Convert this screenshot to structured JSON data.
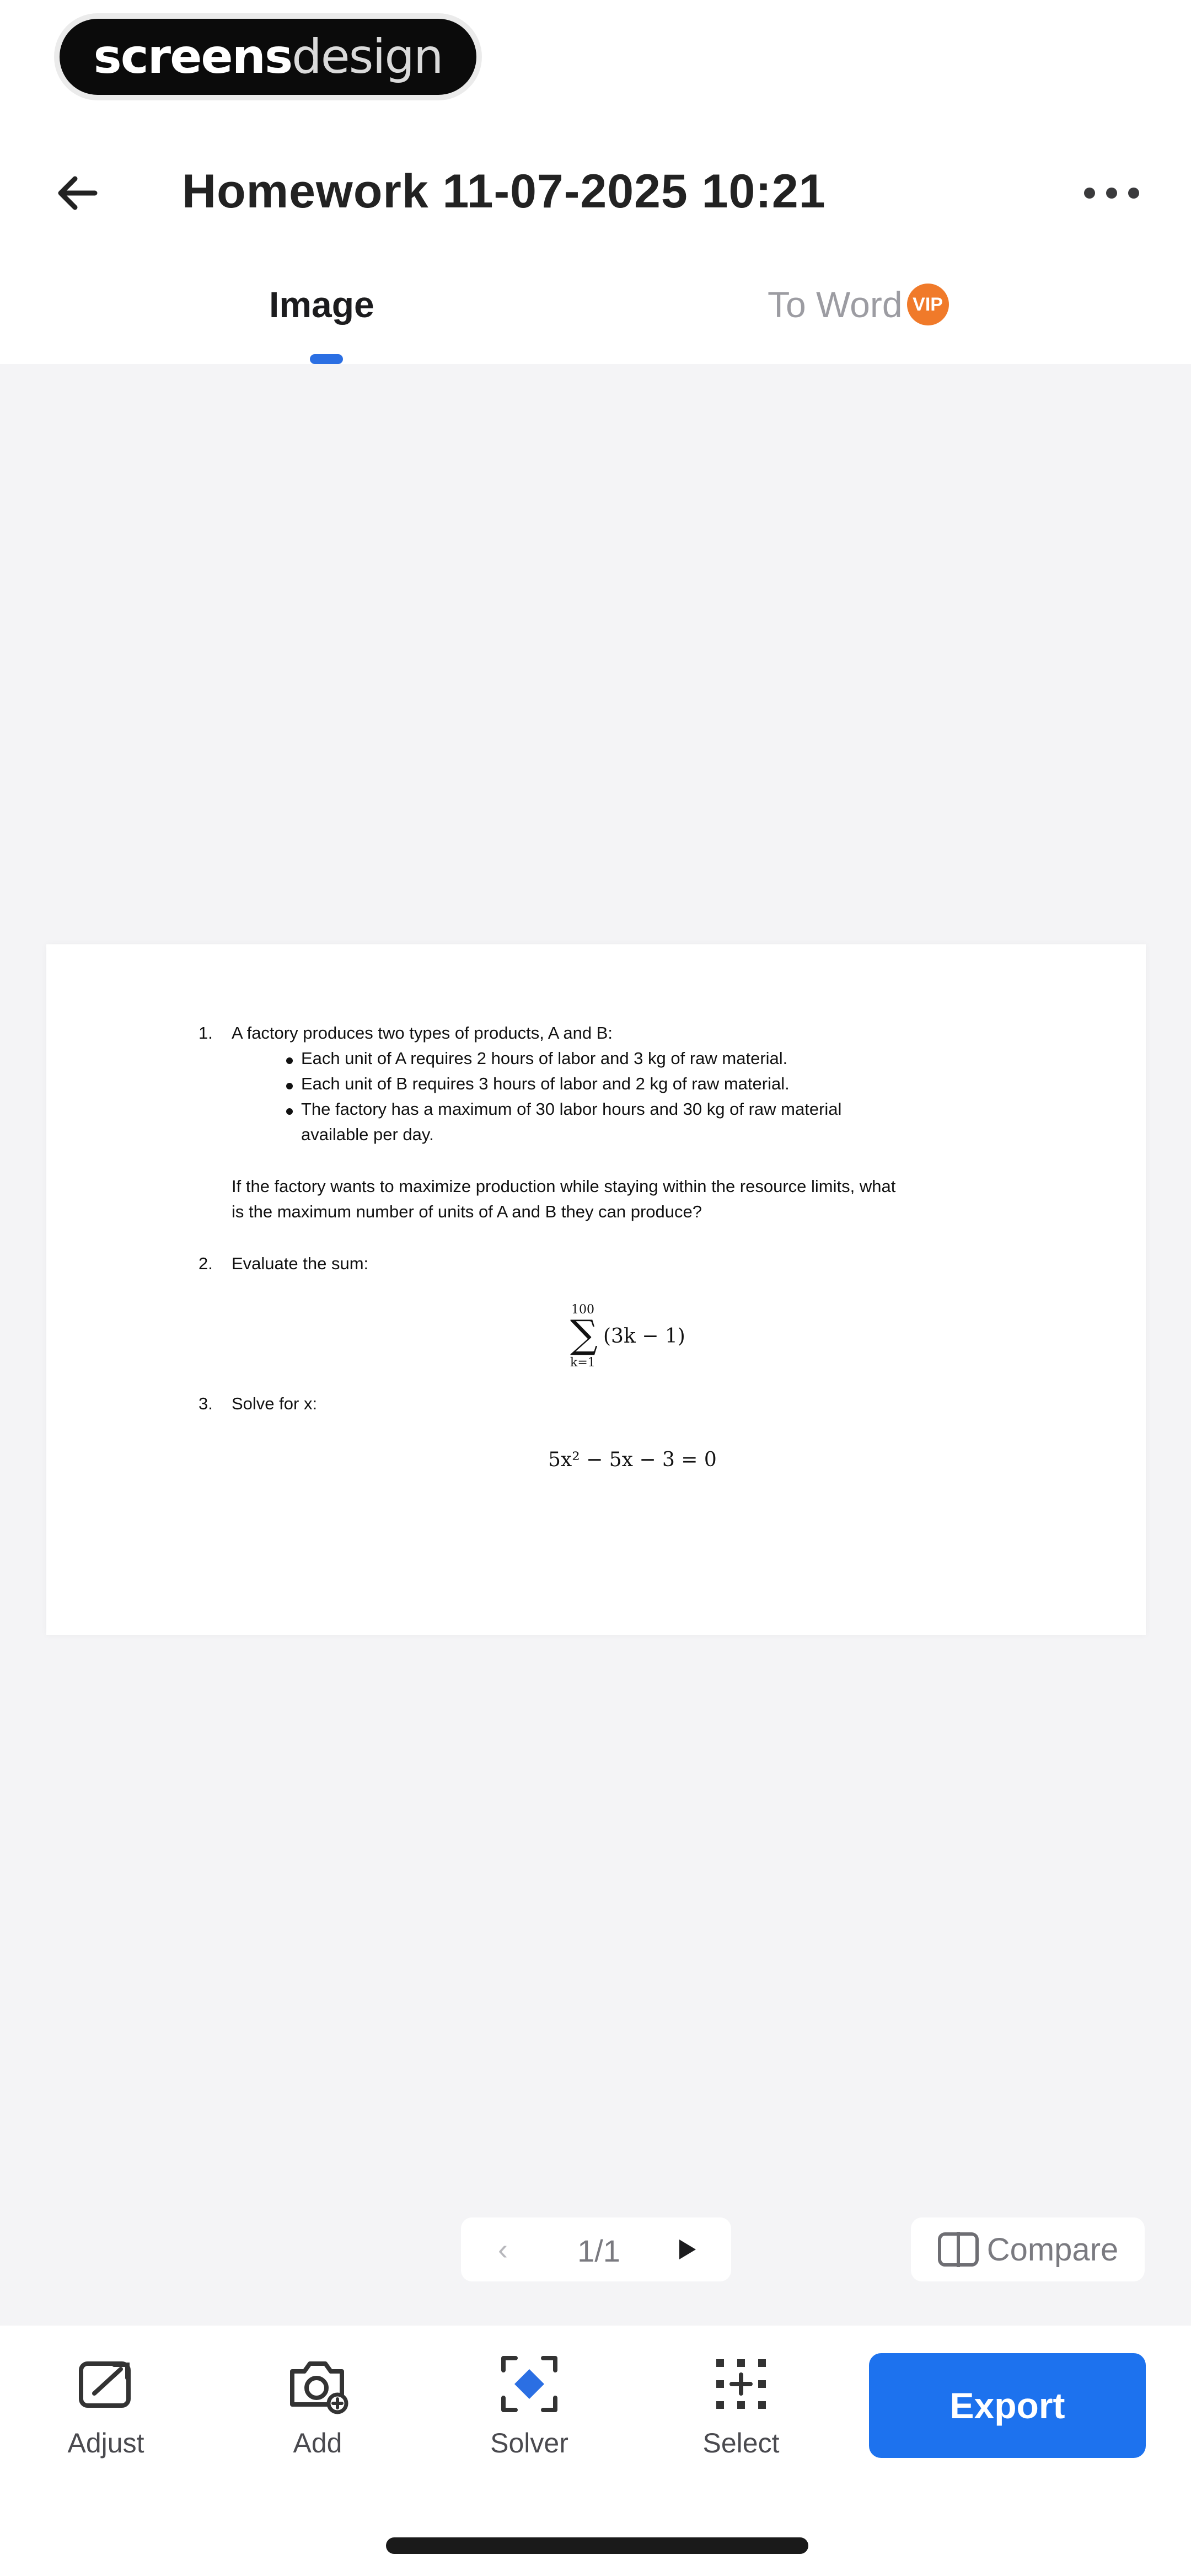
{
  "brand": {
    "bold": "screens",
    "light": "design"
  },
  "header": {
    "title": "Homework 11-07-2025 10:21",
    "back_icon": "arrow-left-icon",
    "more_icon": "more-horizontal-icon"
  },
  "tabs": [
    {
      "label": "Image",
      "active": true
    },
    {
      "label": "To Word",
      "active": false,
      "badge": "VIP"
    }
  ],
  "document": {
    "q1": {
      "number": "1.",
      "text": "A factory produces two types of products, A and B:",
      "bullets": [
        "Each unit of A requires 2 hours of labor and 3 kg of raw material.",
        "Each unit of B requires 3 hours of labor and 2 kg of raw material.",
        "The factory has a maximum of 30 labor hours and 30 kg of raw material"
      ],
      "bullet_cont": "available per day.",
      "question_line1": "If the factory wants to maximize production while staying within the resource limits, what",
      "question_line2": "is the maximum number of units of A and B they can produce?"
    },
    "q2": {
      "number": "2.",
      "text": "Evaluate the sum:",
      "upper": "100",
      "lower": "k=1",
      "expr": "(3k − 1)"
    },
    "q3": {
      "number": "3.",
      "text": "Solve for x:",
      "equation": "5x² − 5x − 3 = 0"
    }
  },
  "pager": {
    "count": "1/1",
    "prev_icon": "chevron-left-icon",
    "next_icon": "play-icon"
  },
  "compare": {
    "label": "Compare",
    "icon": "compare-icon"
  },
  "toolbar": {
    "adjust": "Adjust",
    "add": "Add",
    "solver": "Solver",
    "select": "Select",
    "export": "Export"
  },
  "colors": {
    "accent": "#1d72ee",
    "tab_indicator": "#2b6fe3",
    "vip_badge": "#f07a2a",
    "canvas_bg": "#f4f4f6"
  }
}
